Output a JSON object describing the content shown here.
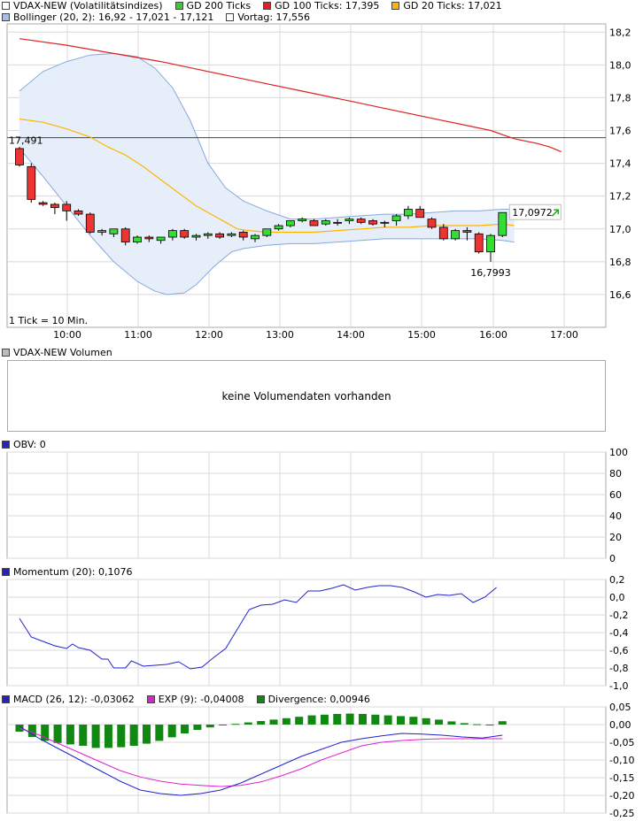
{
  "colors": {
    "candle_up": "#33dd33",
    "candle_down": "#ee3333",
    "gd200": "#33cc33",
    "gd100": "#dd2222",
    "gd20": "#ffb400",
    "bollinger_fill": "#e6eefa",
    "bollinger_line": "#88a8dd",
    "vortag": "#444444",
    "momentum": "#2222cc",
    "macd": "#2222cc",
    "exp": "#dd22cc",
    "divergence": "#118811",
    "obv": "#2222cc",
    "grid": "#d8d8d8"
  },
  "legend_main": {
    "title": "VDAX-NEW (Volatilitätsindizes)",
    "gd200": "GD 200 Ticks",
    "gd100": "GD 100 Ticks: 17,395",
    "gd20": "GD 20 Ticks: 17,021",
    "bollinger": "Bollinger (20, 2): 16,92  - 17,021  - 17,121",
    "vortag": "Vortag: 17,556"
  },
  "volume_panel": {
    "title": "VDAX-NEW Volumen",
    "message": "keine Volumendaten vorhanden"
  },
  "obv_panel": {
    "title": "OBV: 0"
  },
  "momentum_panel": {
    "title": "Momentum (20): 0,1076"
  },
  "macd_panel": {
    "macd_label": "MACD (26, 12): -0,03062",
    "exp_label": "EXP (9): -0,04008",
    "div_label": "Divergence: 0,00946"
  },
  "chart_data": [
    {
      "type": "candlestick",
      "x_ticks": [
        "10:00",
        "11:00",
        "12:00",
        "13:00",
        "14:00",
        "15:00",
        "16:00",
        "17:00"
      ],
      "y_ticks": [
        "18,2",
        "18,0",
        "17,8",
        "17,6",
        "17,4",
        "17,2",
        "17,0",
        "16,8",
        "16,6"
      ],
      "ylim": [
        16.4,
        18.25
      ],
      "tick_note": "1 Tick = 10 Min.",
      "annotations": {
        "vortag_label": "17,491",
        "last_value": "17,0972",
        "low_value": "16,7993"
      },
      "vortag": 17.556,
      "candles": [
        {
          "o": 17.49,
          "h": 17.5,
          "l": 17.38,
          "c": 17.39
        },
        {
          "o": 17.38,
          "h": 17.4,
          "l": 17.16,
          "c": 17.18
        },
        {
          "o": 17.16,
          "h": 17.17,
          "l": 17.14,
          "c": 17.15
        },
        {
          "o": 17.15,
          "h": 17.16,
          "l": 17.09,
          "c": 17.13
        },
        {
          "o": 17.15,
          "h": 17.17,
          "l": 17.05,
          "c": 17.11
        },
        {
          "o": 17.11,
          "h": 17.12,
          "l": 17.08,
          "c": 17.09
        },
        {
          "o": 17.09,
          "h": 17.1,
          "l": 16.97,
          "c": 16.98
        },
        {
          "o": 16.98,
          "h": 17.0,
          "l": 16.96,
          "c": 16.99
        },
        {
          "o": 16.97,
          "h": 17.0,
          "l": 16.95,
          "c": 17.0
        },
        {
          "o": 17.0,
          "h": 17.01,
          "l": 16.9,
          "c": 16.92
        },
        {
          "o": 16.92,
          "h": 16.96,
          "l": 16.91,
          "c": 16.95
        },
        {
          "o": 16.95,
          "h": 16.96,
          "l": 16.92,
          "c": 16.94
        },
        {
          "o": 16.93,
          "h": 16.95,
          "l": 16.91,
          "c": 16.95
        },
        {
          "o": 16.95,
          "h": 17.0,
          "l": 16.93,
          "c": 16.99
        },
        {
          "o": 16.99,
          "h": 17.0,
          "l": 16.94,
          "c": 16.95
        },
        {
          "o": 16.95,
          "h": 16.97,
          "l": 16.93,
          "c": 16.96
        },
        {
          "o": 16.96,
          "h": 16.98,
          "l": 16.94,
          "c": 16.97
        },
        {
          "o": 16.97,
          "h": 16.98,
          "l": 16.94,
          "c": 16.95
        },
        {
          "o": 16.96,
          "h": 16.98,
          "l": 16.95,
          "c": 16.97
        },
        {
          "o": 16.98,
          "h": 16.99,
          "l": 16.93,
          "c": 16.95
        },
        {
          "o": 16.94,
          "h": 16.97,
          "l": 16.92,
          "c": 16.96
        },
        {
          "o": 16.96,
          "h": 17.0,
          "l": 16.95,
          "c": 17.0
        },
        {
          "o": 17.0,
          "h": 17.03,
          "l": 16.99,
          "c": 17.02
        },
        {
          "o": 17.02,
          "h": 17.05,
          "l": 17.01,
          "c": 17.05
        },
        {
          "o": 17.05,
          "h": 17.07,
          "l": 17.04,
          "c": 17.06
        },
        {
          "o": 17.05,
          "h": 17.06,
          "l": 17.02,
          "c": 17.02
        },
        {
          "o": 17.03,
          "h": 17.06,
          "l": 17.02,
          "c": 17.05
        },
        {
          "o": 17.04,
          "h": 17.06,
          "l": 17.02,
          "c": 17.04
        },
        {
          "o": 17.05,
          "h": 17.07,
          "l": 17.03,
          "c": 17.06
        },
        {
          "o": 17.06,
          "h": 17.07,
          "l": 17.03,
          "c": 17.04
        },
        {
          "o": 17.05,
          "h": 17.06,
          "l": 17.02,
          "c": 17.03
        },
        {
          "o": 17.04,
          "h": 17.05,
          "l": 17.01,
          "c": 17.04
        },
        {
          "o": 17.05,
          "h": 17.09,
          "l": 17.02,
          "c": 17.08
        },
        {
          "o": 17.08,
          "h": 17.14,
          "l": 17.06,
          "c": 17.12
        },
        {
          "o": 17.12,
          "h": 17.14,
          "l": 17.07,
          "c": 17.07
        },
        {
          "o": 17.06,
          "h": 17.07,
          "l": 17.0,
          "c": 17.01
        },
        {
          "o": 17.01,
          "h": 17.03,
          "l": 16.93,
          "c": 16.94
        },
        {
          "o": 16.94,
          "h": 17.0,
          "l": 16.93,
          "c": 16.99
        },
        {
          "o": 16.99,
          "h": 17.01,
          "l": 16.93,
          "c": 16.98
        },
        {
          "o": 16.97,
          "h": 16.98,
          "l": 16.85,
          "c": 16.86
        },
        {
          "o": 16.86,
          "h": 16.97,
          "l": 16.8,
          "c": 16.96
        },
        {
          "o": 16.96,
          "h": 17.1,
          "l": 16.95,
          "c": 17.1
        }
      ],
      "gd100": [
        [
          0,
          18.16
        ],
        [
          6,
          18.12
        ],
        [
          12,
          18.06
        ],
        [
          18,
          17.98
        ],
        [
          24,
          17.9
        ],
        [
          30,
          17.84
        ],
        [
          36,
          17.78
        ],
        [
          42,
          17.71
        ],
        [
          48,
          17.64
        ],
        [
          54,
          17.58
        ],
        [
          60,
          17.52
        ],
        [
          66,
          17.47
        ],
        [
          72,
          17.41
        ],
        [
          76,
          17.38
        ],
        [
          82,
          17.36
        ],
        [
          86,
          17.34
        ],
        [
          91,
          17.3
        ],
        [
          96,
          17.25
        ],
        [
          101,
          17.21
        ],
        [
          104,
          17.19
        ],
        [
          110,
          17.18
        ],
        [
          116,
          17.14
        ],
        [
          122,
          17.1
        ],
        [
          128,
          17.06
        ],
        [
          134,
          17.03
        ],
        [
          140,
          17.0
        ],
        [
          143,
          16.98
        ],
        [
          149,
          16.96
        ],
        [
          154,
          16.94
        ],
        [
          158,
          16.93
        ],
        [
          163,
          16.91
        ],
        [
          166,
          16.91
        ],
        [
          167,
          16.88
        ],
        [
          168,
          16.85
        ],
        [
          173,
          16.84
        ],
        [
          181,
          16.83
        ],
        [
          186,
          16.82
        ],
        [
          190,
          16.82
        ],
        [
          200,
          17.0
        ],
        [
          205,
          17.08
        ],
        [
          210,
          17.15
        ],
        [
          215,
          17.22
        ],
        [
          220,
          17.29
        ],
        [
          225,
          17.35
        ],
        [
          230,
          17.41
        ],
        [
          235,
          17.46
        ],
        [
          240,
          17.49
        ]
      ],
      "gd20_pts": [
        [
          0,
          17.67
        ],
        [
          4,
          17.65
        ],
        [
          8,
          17.61
        ],
        [
          12,
          17.56
        ],
        [
          15,
          17.5
        ],
        [
          18,
          17.45
        ],
        [
          21,
          17.38
        ],
        [
          24,
          17.3
        ],
        [
          27,
          17.22
        ],
        [
          30,
          17.14
        ],
        [
          33,
          17.08
        ],
        [
          35,
          17.04
        ],
        [
          37,
          17.0
        ],
        [
          39,
          16.99
        ],
        [
          42,
          16.98
        ],
        [
          46,
          16.98
        ],
        [
          50,
          16.98
        ],
        [
          54,
          16.99
        ],
        [
          58,
          17.0
        ],
        [
          62,
          17.01
        ],
        [
          66,
          17.01
        ],
        [
          70,
          17.02
        ],
        [
          74,
          17.02
        ],
        [
          78,
          17.02
        ],
        [
          82,
          17.03
        ],
        [
          84,
          17.02
        ]
      ],
      "gd100_pts": [
        [
          0,
          18.16
        ],
        [
          8,
          18.12
        ],
        [
          16,
          18.07
        ],
        [
          24,
          18.02
        ],
        [
          32,
          17.96
        ],
        [
          40,
          17.9
        ],
        [
          48,
          17.84
        ],
        [
          56,
          17.78
        ],
        [
          64,
          17.72
        ],
        [
          72,
          17.66
        ],
        [
          80,
          17.6
        ],
        [
          84,
          17.55
        ],
        [
          88,
          17.52
        ],
        [
          90,
          17.5
        ],
        [
          92,
          17.47
        ]
      ],
      "bb_upper": [
        [
          0,
          17.84
        ],
        [
          4,
          17.96
        ],
        [
          8,
          18.02
        ],
        [
          12,
          18.06
        ],
        [
          16,
          18.07
        ],
        [
          20,
          18.05
        ],
        [
          23,
          17.98
        ],
        [
          26,
          17.86
        ],
        [
          29,
          17.66
        ],
        [
          32,
          17.4
        ],
        [
          35,
          17.25
        ],
        [
          38,
          17.17
        ],
        [
          42,
          17.11
        ],
        [
          46,
          17.06
        ],
        [
          50,
          17.06
        ],
        [
          54,
          17.07
        ],
        [
          58,
          17.08
        ],
        [
          62,
          17.09
        ],
        [
          66,
          17.09
        ],
        [
          70,
          17.1
        ],
        [
          74,
          17.11
        ],
        [
          78,
          17.11
        ],
        [
          82,
          17.12
        ],
        [
          84,
          17.12
        ]
      ],
      "bb_lower": [
        [
          0,
          17.49
        ],
        [
          4,
          17.32
        ],
        [
          8,
          17.14
        ],
        [
          12,
          16.96
        ],
        [
          16,
          16.8
        ],
        [
          20,
          16.68
        ],
        [
          23,
          16.62
        ],
        [
          25,
          16.6
        ],
        [
          28,
          16.61
        ],
        [
          30,
          16.66
        ],
        [
          33,
          16.77
        ],
        [
          36,
          16.86
        ],
        [
          38,
          16.88
        ],
        [
          42,
          16.9
        ],
        [
          46,
          16.91
        ],
        [
          50,
          16.91
        ],
        [
          54,
          16.92
        ],
        [
          58,
          16.93
        ],
        [
          62,
          16.94
        ],
        [
          66,
          16.94
        ],
        [
          70,
          16.94
        ],
        [
          74,
          16.94
        ],
        [
          78,
          16.94
        ],
        [
          82,
          16.93
        ],
        [
          84,
          16.92
        ]
      ]
    },
    {
      "type": "line",
      "name": "obv",
      "y_ticks": [
        "100",
        "80",
        "60",
        "40",
        "20",
        "0"
      ],
      "ylim": [
        0,
        100
      ]
    },
    {
      "type": "line",
      "name": "momentum",
      "y_ticks": [
        "0,2",
        "0,0",
        "-0,2",
        "-0,4",
        "-0,6",
        "-0,8",
        "-1,0"
      ],
      "ylim": [
        -1.0,
        0.2
      ],
      "values": [
        [
          0,
          -0.24
        ],
        [
          2,
          -0.45
        ],
        [
          4,
          -0.5
        ],
        [
          6,
          -0.55
        ],
        [
          8,
          -0.58
        ],
        [
          9,
          -0.53
        ],
        [
          10,
          -0.57
        ],
        [
          12,
          -0.6
        ],
        [
          14,
          -0.7
        ],
        [
          15,
          -0.7
        ],
        [
          16,
          -0.8
        ],
        [
          18,
          -0.8
        ],
        [
          19,
          -0.72
        ],
        [
          21,
          -0.78
        ],
        [
          23,
          -0.77
        ],
        [
          25,
          -0.76
        ],
        [
          27,
          -0.73
        ],
        [
          29,
          -0.81
        ],
        [
          31,
          -0.79
        ],
        [
          33,
          -0.68
        ],
        [
          35,
          -0.58
        ],
        [
          37,
          -0.36
        ],
        [
          39,
          -0.14
        ],
        [
          41,
          -0.09
        ],
        [
          43,
          -0.08
        ],
        [
          45,
          -0.03
        ],
        [
          47,
          -0.06
        ],
        [
          49,
          0.07
        ],
        [
          51,
          0.07
        ],
        [
          53,
          0.1
        ],
        [
          55,
          0.14
        ],
        [
          57,
          0.08
        ],
        [
          59,
          0.11
        ],
        [
          61,
          0.13
        ],
        [
          63,
          0.13
        ],
        [
          65,
          0.11
        ],
        [
          67,
          0.06
        ],
        [
          69,
          0.0
        ],
        [
          71,
          0.03
        ],
        [
          73,
          0.02
        ],
        [
          75,
          0.04
        ],
        [
          77,
          -0.06
        ],
        [
          79,
          0.0
        ],
        [
          81,
          0.11
        ]
      ]
    },
    {
      "type": "bar+line",
      "name": "macd",
      "y_ticks": [
        "0,05",
        "0,00",
        "-0,05",
        "-0,10",
        "-0,15",
        "-0,20",
        "-0,25"
      ],
      "ylim": [
        -0.25,
        0.05
      ],
      "divergence": [
        -0.02,
        -0.035,
        -0.046,
        -0.052,
        -0.056,
        -0.06,
        -0.066,
        -0.066,
        -0.064,
        -0.06,
        -0.054,
        -0.046,
        -0.036,
        -0.025,
        -0.015,
        -0.008,
        -0.002,
        0.002,
        0.006,
        0.01,
        0.014,
        0.018,
        0.022,
        0.026,
        0.028,
        0.03,
        0.031,
        0.03,
        0.028,
        0.026,
        0.024,
        0.022,
        0.018,
        0.014,
        0.009,
        0.004,
        0.001,
        0.0,
        0.0095
      ],
      "macd": [
        [
          0,
          -0.005
        ],
        [
          3,
          -0.04
        ],
        [
          6,
          -0.07
        ],
        [
          9,
          -0.1
        ],
        [
          12,
          -0.13
        ],
        [
          15,
          -0.16
        ],
        [
          18,
          -0.185
        ],
        [
          21,
          -0.195
        ],
        [
          24,
          -0.2
        ],
        [
          27,
          -0.195
        ],
        [
          30,
          -0.185
        ],
        [
          33,
          -0.165
        ],
        [
          36,
          -0.14
        ],
        [
          39,
          -0.115
        ],
        [
          42,
          -0.09
        ],
        [
          45,
          -0.07
        ],
        [
          48,
          -0.05
        ],
        [
          51,
          -0.04
        ],
        [
          54,
          -0.032
        ],
        [
          57,
          -0.025
        ],
        [
          60,
          -0.027
        ],
        [
          63,
          -0.03
        ],
        [
          66,
          -0.035
        ],
        [
          69,
          -0.038
        ],
        [
          72,
          -0.03
        ]
      ],
      "exp": [
        [
          0,
          -0.01
        ],
        [
          3,
          -0.03
        ],
        [
          6,
          -0.055
        ],
        [
          9,
          -0.08
        ],
        [
          12,
          -0.105
        ],
        [
          15,
          -0.13
        ],
        [
          18,
          -0.148
        ],
        [
          21,
          -0.16
        ],
        [
          24,
          -0.168
        ],
        [
          27,
          -0.172
        ],
        [
          30,
          -0.175
        ],
        [
          33,
          -0.172
        ],
        [
          36,
          -0.162
        ],
        [
          39,
          -0.145
        ],
        [
          42,
          -0.125
        ],
        [
          45,
          -0.1
        ],
        [
          48,
          -0.08
        ],
        [
          51,
          -0.06
        ],
        [
          54,
          -0.05
        ],
        [
          57,
          -0.045
        ],
        [
          60,
          -0.042
        ],
        [
          63,
          -0.04
        ],
        [
          66,
          -0.04
        ],
        [
          69,
          -0.04
        ],
        [
          72,
          -0.04
        ]
      ]
    }
  ]
}
